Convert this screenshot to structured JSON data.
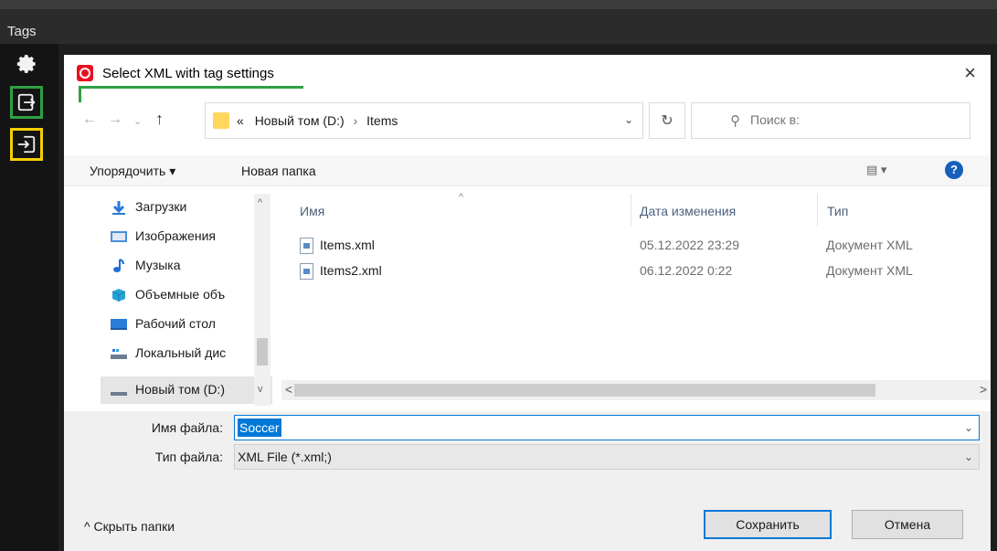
{
  "app": {
    "header_title": "Tags"
  },
  "dialog": {
    "title": "Select XML with tag settings",
    "close_glyph": "×",
    "address": {
      "prefix": "«",
      "drive": "Новый том (D:)",
      "separator": "›",
      "folder": "Items"
    },
    "search_placeholder": "Поиск в:",
    "commands": {
      "organize": "Упорядочить ▾",
      "new_folder": "Новая папка",
      "view": "▾",
      "help": "?"
    },
    "nav_items": [
      {
        "label": "Загрузки",
        "icon": "download-icon",
        "color": "#2b77d8"
      },
      {
        "label": "Изображения",
        "icon": "pictures-icon",
        "color": "#4a90d9"
      },
      {
        "label": "Музыка",
        "icon": "music-icon",
        "color": "#1f6fd1"
      },
      {
        "label": "Объемные объ",
        "icon": "3d-objects-icon",
        "color": "#29a3d6"
      },
      {
        "label": "Рабочий стол",
        "icon": "desktop-icon",
        "color": "#2b7bd8"
      },
      {
        "label": "Локальный дис",
        "icon": "local-disk-icon",
        "color": "#6b7d8f"
      },
      {
        "label": "Новый том (D:)",
        "icon": "drive-icon",
        "color": "#6b7d8f",
        "selected": true
      }
    ],
    "columns": {
      "name": "Имя",
      "date": "Дата изменения",
      "type": "Тип"
    },
    "files": [
      {
        "name": "Items.xml",
        "date": "05.12.2022 23:29",
        "type": "Документ XML"
      },
      {
        "name": "Items2.xml",
        "date": "06.12.2022 0:22",
        "type": "Документ XML"
      }
    ],
    "filename_label": "Имя файла:",
    "filename_value": "Soccer",
    "filetype_label": "Тип файла:",
    "filetype_value": "XML File (*.xml;)",
    "hide_folders": "Скрыть папки",
    "save": "Сохранить",
    "cancel": "Отмена"
  }
}
